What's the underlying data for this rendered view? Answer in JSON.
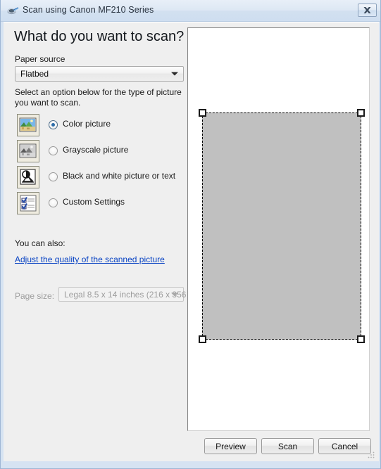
{
  "window": {
    "title": "Scan using Canon MF210 Series",
    "title_icon": "scanner-icon",
    "close_label": "✕",
    "frame_color": "#d6e3f2",
    "body_color": "#efefef"
  },
  "left_panel": {
    "heading": "What do you want to scan?",
    "paper_source_label": "Paper source",
    "paper_source_value": "Flatbed",
    "instruction": "Select an option below for the type of picture you want to scan.",
    "options": [
      {
        "label": "Color picture",
        "icon": "color-picture-icon",
        "selected": true
      },
      {
        "label": "Grayscale picture",
        "icon": "grayscale-picture-icon",
        "selected": false
      },
      {
        "label": "Black and white picture or text",
        "icon": "black-and-white-picture-icon",
        "selected": false
      },
      {
        "label": "Custom Settings",
        "icon": "custom-settings-icon",
        "selected": false
      }
    ],
    "also_label": "You can also:",
    "quality_link": "Adjust the quality of the scanned picture",
    "quality_link_color": "#0b45c4",
    "page_size_label": "Page size:",
    "page_size_value": "Legal 8.5 x 14 inches (216 x 356",
    "page_size_disabled": true
  },
  "preview": {
    "selection_fill": "#c0c0c0",
    "handles": [
      "top-left",
      "top-right",
      "bottom-left",
      "bottom-right"
    ]
  },
  "footer": {
    "preview_label": "Preview",
    "scan_label": "Scan",
    "cancel_label": "Cancel"
  }
}
